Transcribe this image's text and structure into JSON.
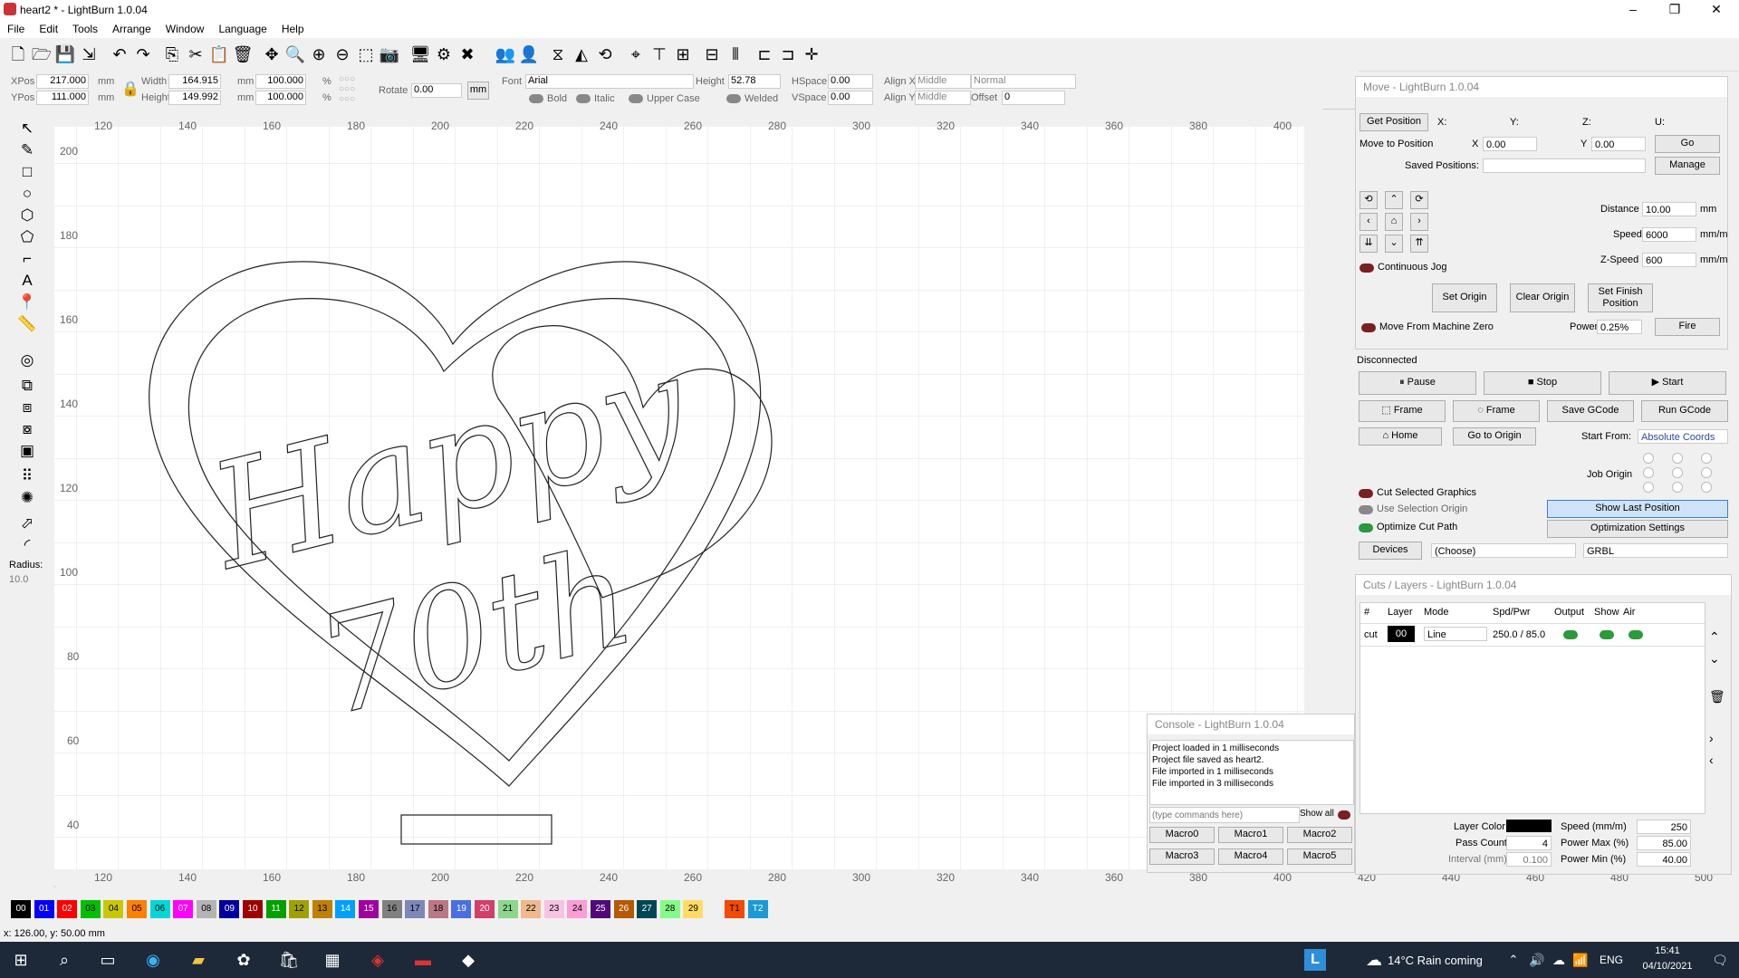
{
  "window": {
    "title": "heart2 * - LightBurn 1.0.04",
    "minimize": "–",
    "maximize": "❐",
    "close": "✕"
  },
  "menu": [
    "File",
    "Edit",
    "Tools",
    "Arrange",
    "Window",
    "Language",
    "Help"
  ],
  "props": {
    "xpos_label": "XPos",
    "xpos": "217.000",
    "ypos_label": "YPos",
    "ypos": "111.000",
    "unit_mm": "mm",
    "width_label": "Width",
    "width": "164.915",
    "height_label": "Height",
    "height": "149.992",
    "scale_w": "100.000",
    "scale_h": "100.000",
    "pct": "%",
    "rotate_label": "Rotate",
    "rotate": "0.00",
    "mm_btn": "mm",
    "font_label": "Font",
    "font": "Arial",
    "fheight_label": "Height",
    "fheight": "52.78",
    "hspace_label": "HSpace",
    "hspace": "0.00",
    "vspace_label": "VSpace",
    "vspace": "0.00",
    "alignx_label": "Align X",
    "alignx": "Middle",
    "aligny_label": "Align Y",
    "aligny": "Middle",
    "style": "Normal",
    "offset_label": "Offset",
    "offset": "0",
    "bold": "Bold",
    "italic": "Italic",
    "upper": "Upper Case",
    "welded": "Welded"
  },
  "left_tools": {
    "radius_label": "Radius:",
    "radius": "10.0"
  },
  "rulers": {
    "top": [
      "120",
      "140",
      "160",
      "180",
      "200",
      "220",
      "240",
      "260",
      "280",
      "300",
      "320",
      "340",
      "360",
      "380",
      "400"
    ],
    "bottom": [
      "120",
      "140",
      "160",
      "180",
      "200",
      "220",
      "240",
      "260",
      "280",
      "300",
      "320",
      "340",
      "360",
      "380",
      "400",
      "420",
      "440",
      "460",
      "480",
      "500"
    ],
    "left": [
      "200",
      "180",
      "160",
      "140",
      "120",
      "100",
      "80",
      "60",
      "40"
    ]
  },
  "move": {
    "title": "Move - LightBurn 1.0.04",
    "get_position": "Get Position",
    "x_lbl": "X:",
    "y_lbl": "Y:",
    "z_lbl": "Z:",
    "u_lbl": "U:",
    "move_to": "Move to Position",
    "mx": "X",
    "mx_val": "0.00",
    "my": "Y",
    "my_val": "0.00",
    "go": "Go",
    "saved": "Saved Positions:",
    "manage": "Manage",
    "distance_lbl": "Distance",
    "distance": "10.00",
    "mm": "mm",
    "speed_lbl": "Speed",
    "speed": "6000",
    "mmm": "mm/m",
    "zspeed_lbl": "Z-Speed",
    "zspeed": "600",
    "continuous": "Continuous Jog",
    "set_origin": "Set Origin",
    "clear_origin": "Clear Origin",
    "set_finish": "Set Finish Position",
    "from_zero": "Move From Machine Zero",
    "power_lbl": "Power",
    "power": "0.25%",
    "fire": "Fire"
  },
  "laser": {
    "status": "Disconnected",
    "pause": "Pause",
    "stop": "Stop",
    "start": "Start",
    "frame1": "Frame",
    "frame2": "Frame",
    "save_gcode": "Save GCode",
    "run_gcode": "Run GCode",
    "home": "Home",
    "go_origin": "Go to Origin",
    "start_from_lbl": "Start From:",
    "start_from": "Absolute Coords",
    "job_origin": "Job Origin",
    "cut_selected": "Cut Selected Graphics",
    "use_sel_origin": "Use Selection Origin",
    "show_last": "Show Last Position",
    "optimize": "Optimize Cut Path",
    "opt_settings": "Optimization Settings",
    "devices": "Devices",
    "choose": "(Choose)",
    "grbl": "GRBL"
  },
  "cuts": {
    "title": "Cuts / Layers - LightBurn 1.0.04",
    "headers": [
      "#",
      "Layer",
      "Mode",
      "Spd/Pwr",
      "Output",
      "Show",
      "Air"
    ],
    "row": {
      "num": "cut",
      "layer": "00",
      "mode": "Line",
      "spdpwr": "250.0 / 85.0"
    },
    "layer_color": "Layer Color",
    "speed_lbl": "Speed (mm/m)",
    "speed": "250",
    "pass_lbl": "Pass Count",
    "pass": "4",
    "pmax_lbl": "Power Max (%)",
    "pmax": "85.00",
    "interval_lbl": "Interval (mm)",
    "interval": "0.100",
    "pmin_lbl": "Power Min (%)",
    "pmin": "40.00"
  },
  "console": {
    "title": "Console - LightBurn 1.0.04",
    "lines": [
      "Project loaded in 1 milliseconds",
      "Project file saved as heart2.",
      "File imported in 1 milliseconds",
      "File imported in 3 milliseconds"
    ],
    "placeholder": "(type commands here)",
    "show_all": "Show all",
    "macros": [
      "Macro0",
      "Macro1",
      "Macro2",
      "Macro3",
      "Macro4",
      "Macro5"
    ]
  },
  "design": {
    "text1": "Happy",
    "text2": "70th"
  },
  "palette": [
    {
      "n": "00",
      "c": "#000000",
      "f": "#ffffff"
    },
    {
      "n": "01",
      "c": "#0000ff",
      "f": "#ffffff"
    },
    {
      "n": "02",
      "c": "#ff0000",
      "f": "#ffffff"
    },
    {
      "n": "03",
      "c": "#00c000",
      "f": "#000000"
    },
    {
      "n": "04",
      "c": "#c8c800",
      "f": "#000000"
    },
    {
      "n": "05",
      "c": "#ff8000",
      "f": "#000000"
    },
    {
      "n": "06",
      "c": "#00d8d8",
      "f": "#000000"
    },
    {
      "n": "07",
      "c": "#ff00ff",
      "f": "#ffffff"
    },
    {
      "n": "08",
      "c": "#b4b4b4",
      "f": "#000000"
    },
    {
      "n": "09",
      "c": "#0000a0",
      "f": "#ffffff"
    },
    {
      "n": "10",
      "c": "#a00000",
      "f": "#ffffff"
    },
    {
      "n": "11",
      "c": "#00a000",
      "f": "#ffffff"
    },
    {
      "n": "12",
      "c": "#a0a000",
      "f": "#000000"
    },
    {
      "n": "13",
      "c": "#c08000",
      "f": "#000000"
    },
    {
      "n": "14",
      "c": "#00a0ff",
      "f": "#ffffff"
    },
    {
      "n": "15",
      "c": "#a000a0",
      "f": "#ffffff"
    },
    {
      "n": "16",
      "c": "#808080",
      "f": "#000000"
    },
    {
      "n": "17",
      "c": "#7d87b9",
      "f": "#000000"
    },
    {
      "n": "18",
      "c": "#bb7784",
      "f": "#000000"
    },
    {
      "n": "19",
      "c": "#4a6fe3",
      "f": "#ffffff"
    },
    {
      "n": "20",
      "c": "#d33f6a",
      "f": "#ffffff"
    },
    {
      "n": "21",
      "c": "#8cd78c",
      "f": "#000000"
    },
    {
      "n": "22",
      "c": "#f0b98d",
      "f": "#000000"
    },
    {
      "n": "23",
      "c": "#f6c4e1",
      "f": "#000000"
    },
    {
      "n": "24",
      "c": "#fa9ed4",
      "f": "#000000"
    },
    {
      "n": "25",
      "c": "#500a78",
      "f": "#ffffff"
    },
    {
      "n": "26",
      "c": "#b45a00",
      "f": "#ffffff"
    },
    {
      "n": "27",
      "c": "#004754",
      "f": "#ffffff"
    },
    {
      "n": "28",
      "c": "#86fa88",
      "f": "#000000"
    },
    {
      "n": "29",
      "c": "#ffdb66",
      "f": "#000000"
    },
    {
      "n": "T1",
      "c": "#f34b00",
      "f": "#000000"
    },
    {
      "n": "T2",
      "c": "#1a9bd6",
      "f": "#ffffff"
    }
  ],
  "status": {
    "coords": "x: 126.00, y: 50.00 mm"
  },
  "taskbar": {
    "weather": "14°C  Rain coming",
    "lang": "ENG",
    "time": "15:41",
    "date": "04/10/2021"
  }
}
